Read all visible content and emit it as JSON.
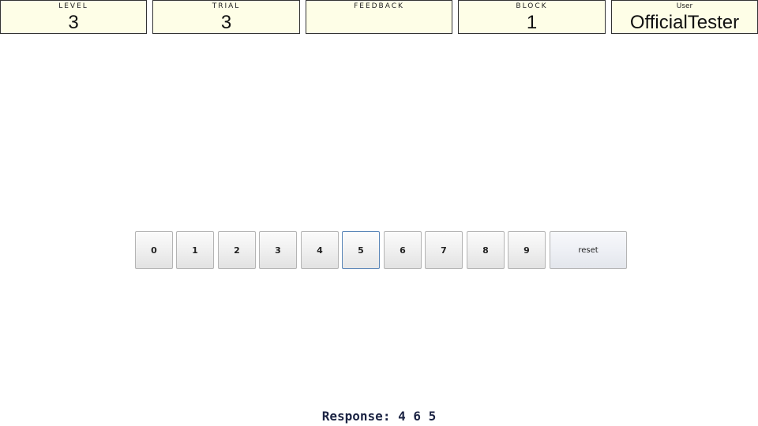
{
  "status_bar": {
    "level": {
      "label": "LEVEL",
      "value": "3"
    },
    "trial": {
      "label": "TRIAL",
      "value": "3"
    },
    "feedback": {
      "label": "FEEDBACK",
      "value": ""
    },
    "block": {
      "label": "BLOCK",
      "value": "1"
    },
    "user": {
      "label": "User",
      "value": "OfficialTester"
    }
  },
  "keypad": {
    "digits": [
      "0",
      "1",
      "2",
      "3",
      "4",
      "5",
      "6",
      "7",
      "8",
      "9"
    ],
    "focused_key": "5",
    "reset_label": "reset"
  },
  "response": {
    "text": "Response: 4 6 5"
  },
  "colors": {
    "status_background": "#fefee7",
    "focus_border": "#5a86b8",
    "response_text": "#1c2444"
  }
}
